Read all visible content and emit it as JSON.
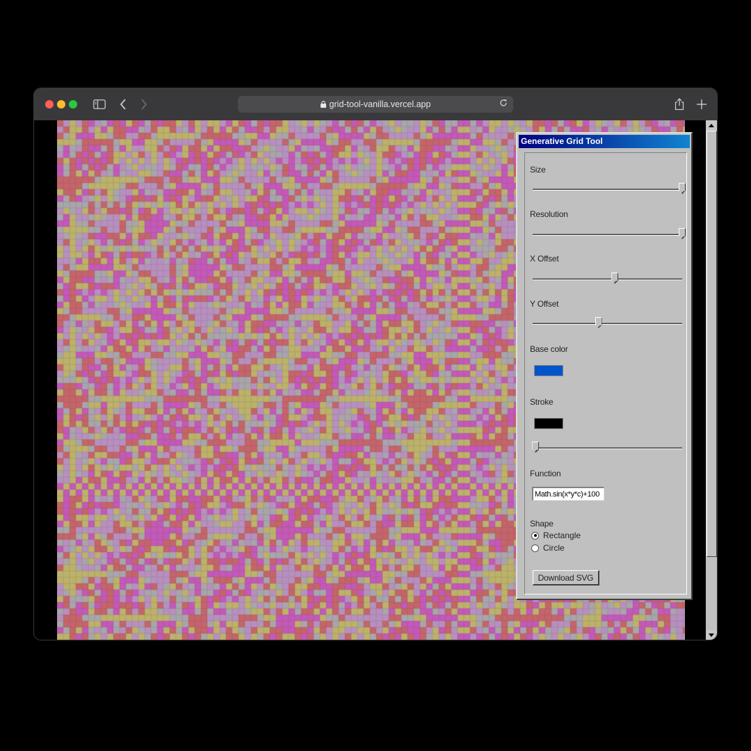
{
  "browser": {
    "url": "grid-tool-vanilla.vercel.app"
  },
  "panel": {
    "title": "Generative Grid Tool",
    "size": {
      "label": "Size",
      "value": 1.0
    },
    "resolution": {
      "label": "Resolution",
      "value": 1.0
    },
    "x_offset": {
      "label": "X Offset",
      "value": 0.55
    },
    "y_offset": {
      "label": "Y Offset",
      "value": 0.44
    },
    "base_color": {
      "label": "Base color",
      "value": "#0055cc"
    },
    "stroke": {
      "label": "Stroke",
      "color": "#000000",
      "width_value": 0.02
    },
    "function": {
      "label": "Function",
      "value": "Math.sin(x*y*c)+100"
    },
    "shape": {
      "label": "Shape",
      "options": [
        "Rectangle",
        "Circle"
      ],
      "selected": "Rectangle"
    },
    "download_label": "Download SVG"
  },
  "colors": {
    "magenta": "#c459b8",
    "yellow": "#bdb26a",
    "gray": "#a9a5ab",
    "red": "#c5656a",
    "lilac": "#b890c0"
  }
}
